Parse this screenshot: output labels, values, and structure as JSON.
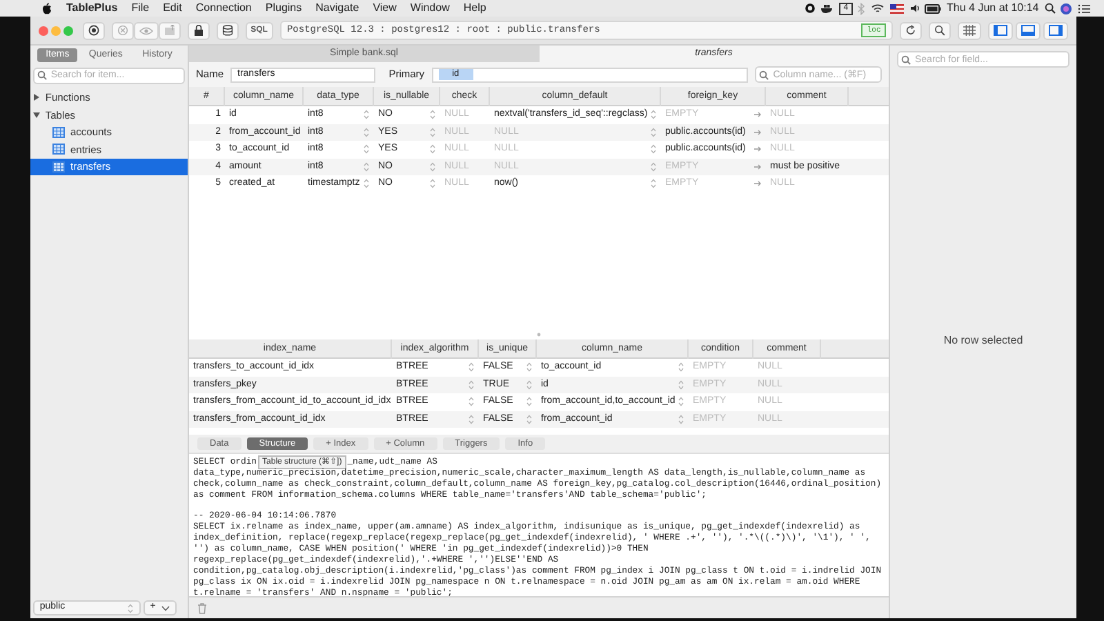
{
  "menubar": {
    "app": "TablePlus",
    "menus": [
      "File",
      "Edit",
      "Connection",
      "Plugins",
      "Navigate",
      "View",
      "Window",
      "Help"
    ],
    "badge": "4",
    "clock": "Thu 4 Jun at 10:14"
  },
  "toolbar": {
    "sql_label": "SQL",
    "connection": "PostgreSQL 12.3 : postgres12 : root : public.transfers",
    "env_tag": "loc"
  },
  "sidebar": {
    "tabs": [
      {
        "label": "Items",
        "selected": true
      },
      {
        "label": "Queries",
        "selected": false
      },
      {
        "label": "History",
        "selected": false
      }
    ],
    "search": {
      "placeholder": "Search for item..."
    },
    "tree": [
      {
        "label": "Functions",
        "expanded": false
      },
      {
        "label": "Tables",
        "expanded": true,
        "children": [
          {
            "label": "accounts",
            "selected": false
          },
          {
            "label": "entries",
            "selected": false
          },
          {
            "label": "transfers",
            "selected": true
          }
        ]
      }
    ],
    "schema": "public",
    "add_label": "+"
  },
  "tabs": [
    {
      "label": "Simple bank.sql",
      "selected": false
    },
    {
      "label": "transfers",
      "selected": true
    }
  ],
  "name_row": {
    "name_label": "Name",
    "name_value": "transfers",
    "primary_label": "Primary",
    "primary_keys": [
      "id"
    ],
    "column_search": {
      "placeholder": "Column name... (⌘F)"
    }
  },
  "columns_table": {
    "columns": [
      {
        "label": "#",
        "kind": "plain"
      },
      {
        "label": "column_name",
        "kind": "plain"
      },
      {
        "label": "data_type",
        "kind": "stepper"
      },
      {
        "label": "is_nullable",
        "kind": "stepper"
      },
      {
        "label": "check",
        "kind": "plain"
      },
      {
        "label": "column_default",
        "kind": "stepper"
      },
      {
        "label": "foreign_key",
        "kind": "link"
      },
      {
        "label": "comment",
        "kind": "plain"
      }
    ],
    "rows": [
      {
        "cells": [
          {
            "text": "1",
            "dim": false
          },
          {
            "text": "id",
            "dim": false
          },
          {
            "text": "int8",
            "dim": false
          },
          {
            "text": "NO",
            "dim": false
          },
          {
            "text": "NULL",
            "dim": true
          },
          {
            "text": "nextval('transfers_id_seq'::regclass)",
            "dim": false
          },
          {
            "text": "EMPTY",
            "dim": true
          },
          {
            "text": "NULL",
            "dim": true
          }
        ]
      },
      {
        "cells": [
          {
            "text": "2",
            "dim": false
          },
          {
            "text": "from_account_id",
            "dim": false
          },
          {
            "text": "int8",
            "dim": false
          },
          {
            "text": "YES",
            "dim": false
          },
          {
            "text": "NULL",
            "dim": true
          },
          {
            "text": "NULL",
            "dim": true
          },
          {
            "text": "public.accounts(id)",
            "dim": false
          },
          {
            "text": "NULL",
            "dim": true
          }
        ]
      },
      {
        "cells": [
          {
            "text": "3",
            "dim": false
          },
          {
            "text": "to_account_id",
            "dim": false
          },
          {
            "text": "int8",
            "dim": false
          },
          {
            "text": "YES",
            "dim": false
          },
          {
            "text": "NULL",
            "dim": true
          },
          {
            "text": "NULL",
            "dim": true
          },
          {
            "text": "public.accounts(id)",
            "dim": false
          },
          {
            "text": "NULL",
            "dim": true
          }
        ]
      },
      {
        "cells": [
          {
            "text": "4",
            "dim": false
          },
          {
            "text": "amount",
            "dim": false
          },
          {
            "text": "int8",
            "dim": false
          },
          {
            "text": "NO",
            "dim": false
          },
          {
            "text": "NULL",
            "dim": true
          },
          {
            "text": "NULL",
            "dim": true
          },
          {
            "text": "EMPTY",
            "dim": true
          },
          {
            "text": "must be positive",
            "dim": false
          }
        ]
      },
      {
        "cells": [
          {
            "text": "5",
            "dim": false
          },
          {
            "text": "created_at",
            "dim": false
          },
          {
            "text": "timestamptz",
            "dim": false
          },
          {
            "text": "NO",
            "dim": false
          },
          {
            "text": "NULL",
            "dim": true
          },
          {
            "text": "now()",
            "dim": false
          },
          {
            "text": "EMPTY",
            "dim": true
          },
          {
            "text": "NULL",
            "dim": true
          }
        ]
      }
    ]
  },
  "index_table": {
    "columns": [
      {
        "label": "index_name",
        "kind": "plain"
      },
      {
        "label": "index_algorithm",
        "kind": "stepper"
      },
      {
        "label": "is_unique",
        "kind": "stepper"
      },
      {
        "label": "column_name",
        "kind": "stepper"
      },
      {
        "label": "condition",
        "kind": "plain"
      },
      {
        "label": "comment",
        "kind": "plain"
      }
    ],
    "rows": [
      {
        "cells": [
          {
            "text": "transfers_to_account_id_idx",
            "dim": false
          },
          {
            "text": "BTREE",
            "dim": false
          },
          {
            "text": "FALSE",
            "dim": false
          },
          {
            "text": "to_account_id",
            "dim": false
          },
          {
            "text": "EMPTY",
            "dim": true
          },
          {
            "text": "NULL",
            "dim": true
          }
        ]
      },
      {
        "cells": [
          {
            "text": "transfers_pkey",
            "dim": false
          },
          {
            "text": "BTREE",
            "dim": false
          },
          {
            "text": "TRUE",
            "dim": false
          },
          {
            "text": "id",
            "dim": false
          },
          {
            "text": "EMPTY",
            "dim": true
          },
          {
            "text": "NULL",
            "dim": true
          }
        ]
      },
      {
        "cells": [
          {
            "text": "transfers_from_account_id_to_account_id_idx",
            "dim": false
          },
          {
            "text": "BTREE",
            "dim": false
          },
          {
            "text": "FALSE",
            "dim": false
          },
          {
            "text": "from_account_id,to_account_id",
            "dim": false
          },
          {
            "text": "EMPTY",
            "dim": true
          },
          {
            "text": "NULL",
            "dim": true
          }
        ]
      },
      {
        "cells": [
          {
            "text": "transfers_from_account_id_idx",
            "dim": false
          },
          {
            "text": "BTREE",
            "dim": false
          },
          {
            "text": "FALSE",
            "dim": false
          },
          {
            "text": "from_account_id",
            "dim": false
          },
          {
            "text": "EMPTY",
            "dim": true
          },
          {
            "text": "NULL",
            "dim": true
          }
        ]
      }
    ]
  },
  "bottom_tabs": [
    {
      "label": "Data",
      "selected": false
    },
    {
      "label": "Structure",
      "selected": true
    },
    {
      "label": "+ Index",
      "selected": false
    },
    {
      "label": "+ Column",
      "selected": false
    },
    {
      "label": "Triggers",
      "selected": false
    },
    {
      "label": "Info",
      "selected": false
    }
  ],
  "tooltip": "Table structure (⌘⇧])",
  "log": [
    {
      "kind": "split",
      "parts": [
        "SELECT ordin",
        "_name,udt_name AS"
      ]
    },
    {
      "kind": "text",
      "text": "data_type,numeric_precision,datetime_precision,numeric_scale,character_maximum_length AS data_length,is_nullable,column_name as"
    },
    {
      "kind": "text",
      "text": "check,column_name as check_constraint,column_default,column_name AS foreign_key,pg_catalog.col_description(16446,ordinal_position)"
    },
    {
      "kind": "text",
      "text": "as comment FROM information_schema.columns WHERE table_name='transfers'AND table_schema='public';"
    },
    {
      "kind": "gap"
    },
    {
      "kind": "text",
      "text": "-- 2020-06-04 10:14:06.7870"
    },
    {
      "kind": "text",
      "text": "SELECT ix.relname as index_name, upper(am.amname) AS index_algorithm, indisunique as is_unique, pg_get_indexdef(indexrelid) as"
    },
    {
      "kind": "text",
      "text": "index_definition, replace(regexp_replace(regexp_replace(pg_get_indexdef(indexrelid), ' WHERE .+', ''), '.*\\((.*)\\)', '\\1'), ' ',"
    },
    {
      "kind": "text",
      "text": "'') as column_name, CASE WHEN position(' WHERE 'in pg_get_indexdef(indexrelid))>0 THEN"
    },
    {
      "kind": "text",
      "text": "regexp_replace(pg_get_indexdef(indexrelid),'.+WHERE ','')ELSE''END AS"
    },
    {
      "kind": "text",
      "text": "condition,pg_catalog.obj_description(i.indexrelid,'pg_class')as comment FROM pg_index i JOIN pg_class t ON t.oid = i.indrelid JOIN"
    },
    {
      "kind": "text",
      "text": "pg_class ix ON ix.oid = i.indexrelid JOIN pg_namespace n ON t.relnamespace = n.oid JOIN pg_am as am ON ix.relam = am.oid WHERE"
    },
    {
      "kind": "text",
      "text": "t.relname = 'transfers' AND n.nspname = 'public';"
    }
  ],
  "right_panel": {
    "search": {
      "placeholder": "Search for field..."
    },
    "empty_text": "No row selected"
  }
}
